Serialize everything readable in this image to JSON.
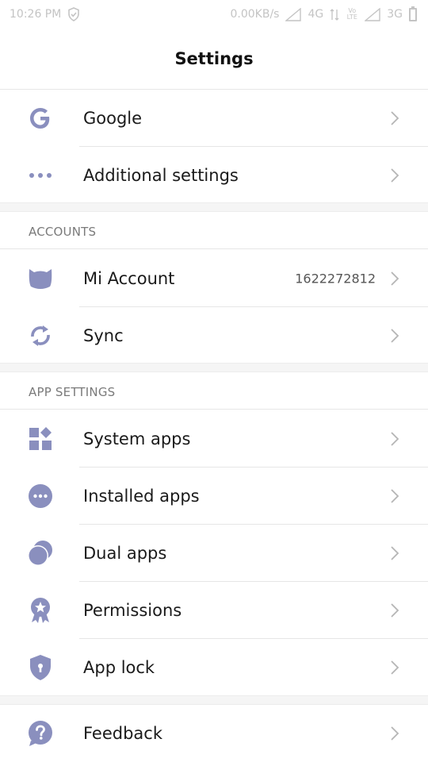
{
  "status_bar": {
    "time": "10:26 PM",
    "net_speed": "0.00KB/s",
    "network_1": "4G",
    "volte_top": "Vo",
    "volte_bottom": "LTE",
    "network_2": "3G"
  },
  "header": {
    "title": "Settings"
  },
  "colors": {
    "icon": "#8a8fbe",
    "divider": "#e6e6e6",
    "section_text": "#7a7a7a"
  },
  "top_items": [
    {
      "label": "Google",
      "icon": "google-icon"
    },
    {
      "label": "Additional settings",
      "icon": "more-dots-icon"
    }
  ],
  "accounts": {
    "header": "ACCOUNTS",
    "items": [
      {
        "label": "Mi Account",
        "value": "1622272812",
        "icon": "mi-account-icon"
      },
      {
        "label": "Sync",
        "icon": "sync-icon"
      }
    ]
  },
  "app_settings": {
    "header": "APP SETTINGS",
    "items": [
      {
        "label": "System apps",
        "icon": "system-apps-icon"
      },
      {
        "label": "Installed apps",
        "icon": "installed-apps-icon"
      },
      {
        "label": "Dual apps",
        "icon": "dual-apps-icon"
      },
      {
        "label": "Permissions",
        "icon": "permissions-icon"
      },
      {
        "label": "App lock",
        "icon": "app-lock-icon"
      }
    ]
  },
  "bottom_items": [
    {
      "label": "Feedback",
      "icon": "feedback-icon"
    }
  ]
}
